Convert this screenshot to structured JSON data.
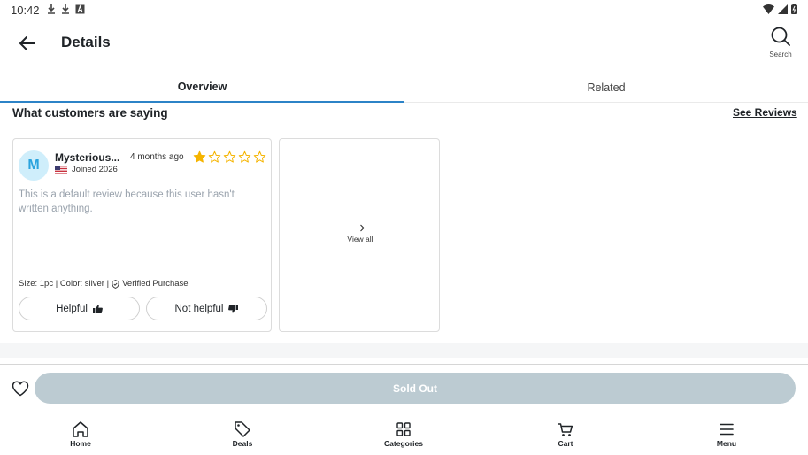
{
  "status_bar": {
    "time": "10:42"
  },
  "header": {
    "title": "Details",
    "search_label": "Search"
  },
  "tabs": [
    {
      "label": "Overview",
      "active": true
    },
    {
      "label": "Related",
      "active": false
    }
  ],
  "reviews_section": {
    "title": "What customers are saying",
    "see_reviews_label": "See Reviews",
    "review": {
      "avatar_initial": "M",
      "reviewer_name": "Mysterious...",
      "time_ago": "4 months ago",
      "rating": 1,
      "max_rating": 5,
      "joined": "Joined 2026",
      "text": "This is a default review because this user hasn't written anything.",
      "size_color": "Size: 1pc | Color: silver |",
      "verified": "Verified Purchase",
      "helpful_label": "Helpful",
      "not_helpful_label": "Not helpful"
    },
    "view_all_label": "View all"
  },
  "action_bar": {
    "sold_out_label": "Sold Out"
  },
  "nav": [
    {
      "label": "Home",
      "icon": "home-icon"
    },
    {
      "label": "Deals",
      "icon": "tag-icon"
    },
    {
      "label": "Categories",
      "icon": "grid-icon"
    },
    {
      "label": "Cart",
      "icon": "cart-icon"
    },
    {
      "label": "Menu",
      "icon": "menu-icon"
    }
  ],
  "colors": {
    "accent": "#2c83c7",
    "star": "#f5b400",
    "sold_out_bg": "#bccbd2",
    "avatar_bg": "#cfeefb",
    "avatar_fg": "#2aa3de"
  }
}
